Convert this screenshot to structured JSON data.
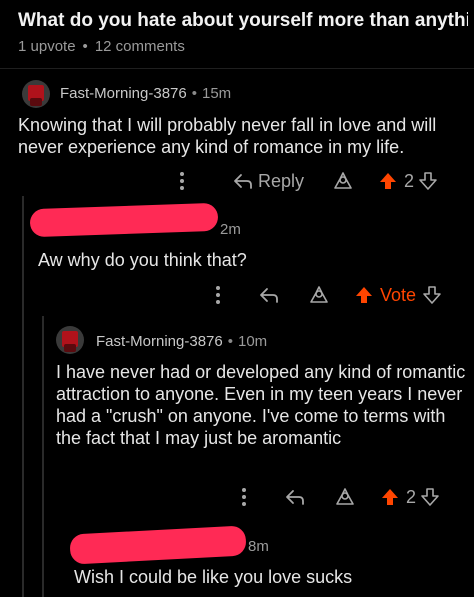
{
  "post": {
    "title": "What do you hate about yourself more than anythin...",
    "upvotes": "1 upvote",
    "comments": "12 comments"
  },
  "comments": [
    {
      "username": "Fast-Morning-3876",
      "time": "15m",
      "body": "Knowing that I will probably never fall in love and will never experience any kind of romance in my life.",
      "reply_label": "Reply",
      "score": "2"
    },
    {
      "time": "2m",
      "body": "Aw why do you think that?",
      "vote_label": "Vote"
    },
    {
      "username": "Fast-Morning-3876",
      "time": "10m",
      "body": "I have never had or developed any kind of romantic attraction to anyone. Even in my teen years I never had a \"crush\" on anyone. I've come to terms with the fact that I may just be aromantic",
      "score": "2"
    },
    {
      "time": "8m",
      "body": "Wish I could be like you love sucks"
    }
  ],
  "separator": "•",
  "colors": {
    "background": "#000000",
    "accent": "#ff4500",
    "redaction": "#ff2a55"
  },
  "icons": [
    "more-vertical-icon",
    "reply-arrow-icon",
    "award-icon",
    "upvote-arrow-icon",
    "downvote-arrow-icon"
  ]
}
